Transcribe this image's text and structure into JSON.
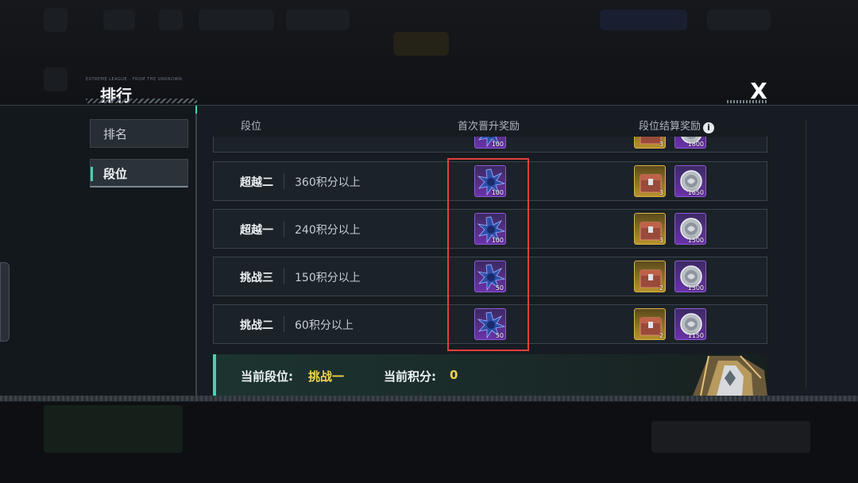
{
  "window": {
    "title": "排行",
    "title_deco": "EXTREME LEAGUE · FROM THE UNKNOWN",
    "close_glyph": "X"
  },
  "sidebar": {
    "tabs": [
      {
        "label": "排名",
        "active": false
      },
      {
        "label": "段位",
        "active": true
      }
    ]
  },
  "table": {
    "headers": {
      "tier": "段位",
      "first_reward": "首次晋升奖励",
      "settle_reward": "段位结算奖励",
      "info_glyph": "i"
    },
    "partial_row": {
      "first_reward_qty": "100",
      "chest_qty": "3",
      "coin_qty": "1800"
    },
    "rows": [
      {
        "tier": "超越二",
        "requirement": "360积分以上",
        "first_reward_qty": "100",
        "chest_qty": "3",
        "coin_qty": "1650"
      },
      {
        "tier": "超越一",
        "requirement": "240积分以上",
        "first_reward_qty": "100",
        "chest_qty": "3",
        "coin_qty": "1500"
      },
      {
        "tier": "挑战三",
        "requirement": "150积分以上",
        "first_reward_qty": "50",
        "chest_qty": "2",
        "coin_qty": "1300"
      },
      {
        "tier": "挑战二",
        "requirement": "60积分以上",
        "first_reward_qty": "50",
        "chest_qty": "2",
        "coin_qty": "1150"
      }
    ]
  },
  "status": {
    "tier_label": "当前段位:",
    "tier_value": "挑战一",
    "score_label": "当前积分:",
    "score_value": "0"
  },
  "colors": {
    "accent": "#46d1b4",
    "highlight_box": "#e0403c",
    "current_value": "#f2d24b",
    "epic_purple": "#6a32a8",
    "legend_gold": "#b8922b"
  },
  "icons": {
    "first_reward": "spiky-crystal-icon",
    "chest": "supply-chest-icon",
    "coin": "silver-coin-icon",
    "badge": "rank-badge-icon"
  }
}
